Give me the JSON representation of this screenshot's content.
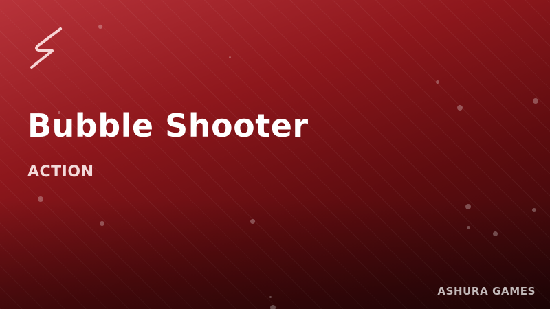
{
  "game": {
    "title": "Bubble Shooter",
    "category": "ACTION",
    "publisher": "ASHURA GAMES",
    "logo_icon": "lightning-bolt-icon"
  },
  "colors": {
    "background_top": "#b8333a",
    "background_bottom": "#2a0608",
    "title": "#ffffff",
    "category": "#f3dada"
  }
}
